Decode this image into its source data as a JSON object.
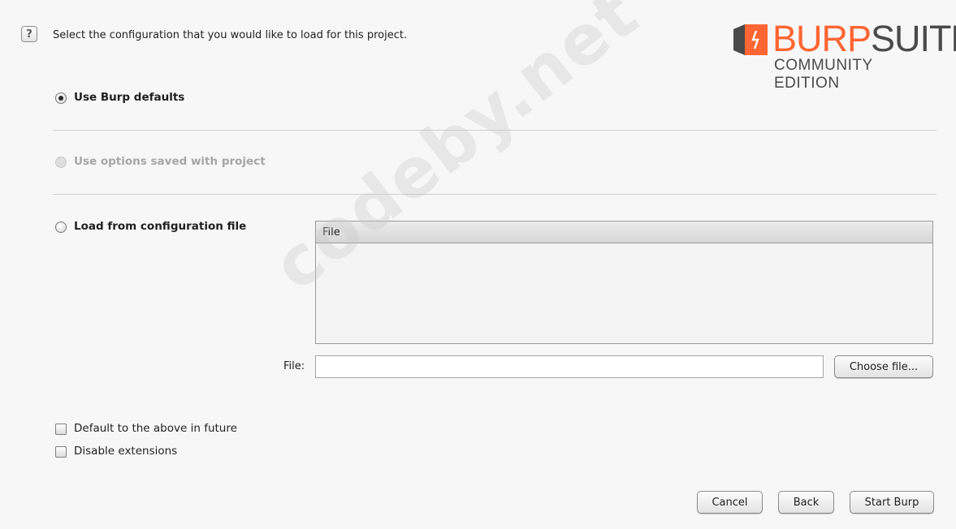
{
  "prompt": "Select the configuration that you would like to load for this project.",
  "help_icon": "question-mark-icon",
  "logo": {
    "burp": "BURP",
    "suite": "SUITE",
    "edition": "COMMUNITY EDITION",
    "accent": "#ff6633",
    "text_color": "#4a4a4a"
  },
  "options": [
    {
      "label": "Use Burp defaults",
      "selected": true,
      "enabled": true
    },
    {
      "label": "Use options saved with project",
      "selected": false,
      "enabled": false
    },
    {
      "label": "Load from configuration file",
      "selected": false,
      "enabled": true
    }
  ],
  "file_table": {
    "header": "File"
  },
  "file_field": {
    "label": "File:",
    "value": ""
  },
  "choose_file_label": "Choose file...",
  "checkboxes": [
    {
      "label": "Default to the above in future",
      "checked": false
    },
    {
      "label": "Disable extensions",
      "checked": false
    }
  ],
  "buttons": {
    "cancel": "Cancel",
    "back": "Back",
    "start": "Start Burp"
  },
  "watermark": "codeby.net"
}
